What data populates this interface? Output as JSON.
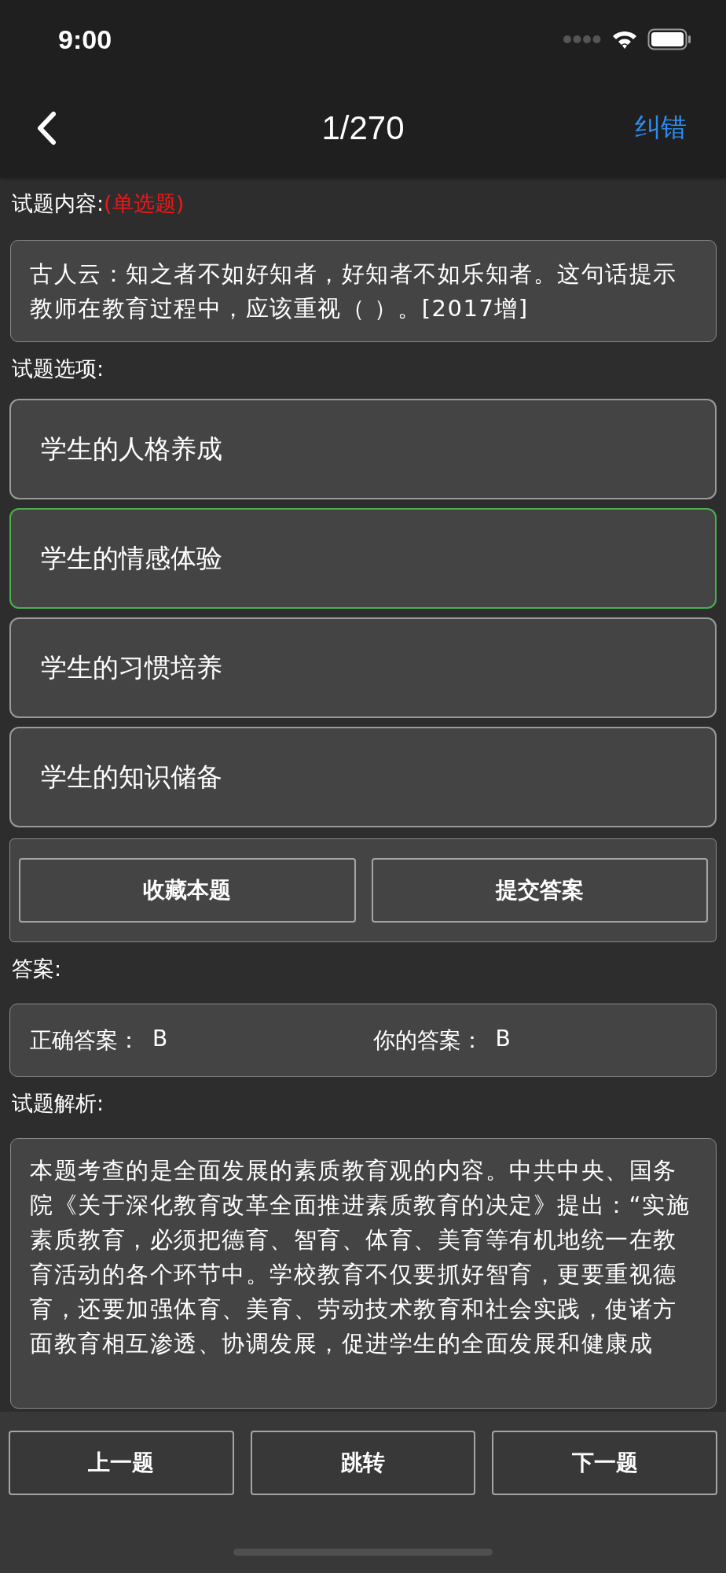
{
  "status_bar": {
    "time": "9:00"
  },
  "nav": {
    "title": "1/270",
    "action": "纠错"
  },
  "question": {
    "label": "试题内容:",
    "type": "(单选题)",
    "text": "古人云：知之者不如好知者，好知者不如乐知者。这句话提示教师在教育过程中，应该重视（ ）。[2017增]"
  },
  "options_label": "试题选项:",
  "options": [
    {
      "text": "学生的人格养成",
      "selected": false
    },
    {
      "text": "学生的情感体验",
      "selected": true
    },
    {
      "text": "学生的习惯培养",
      "selected": false
    },
    {
      "text": "学生的知识储备",
      "selected": false
    }
  ],
  "actions": [
    "收藏本题",
    "提交答案"
  ],
  "answer": {
    "label": "答案:",
    "correct_label": "正确答案：",
    "correct": "B",
    "yours_label": "你的答案：",
    "yours": "B"
  },
  "analysis": {
    "label": "试题解析:",
    "text": "本题考查的是全面发展的素质教育观的内容。中共中央、国务院《关于深化教育改革全面推进素质教育的决定》提出：“实施素质教育，必须把德育、智育、体育、美育等有机地统一在教育活动的各个环节中。学校教育不仅要抓好智育，更要重视德育，还要加强体育、美育、劳动技术教育和社会实践，使诸方面教育相互渗透、协调发展，促进学生的全面发展和健康成"
  },
  "bottom_buttons": [
    "上一题",
    "跳转",
    "下一题"
  ]
}
